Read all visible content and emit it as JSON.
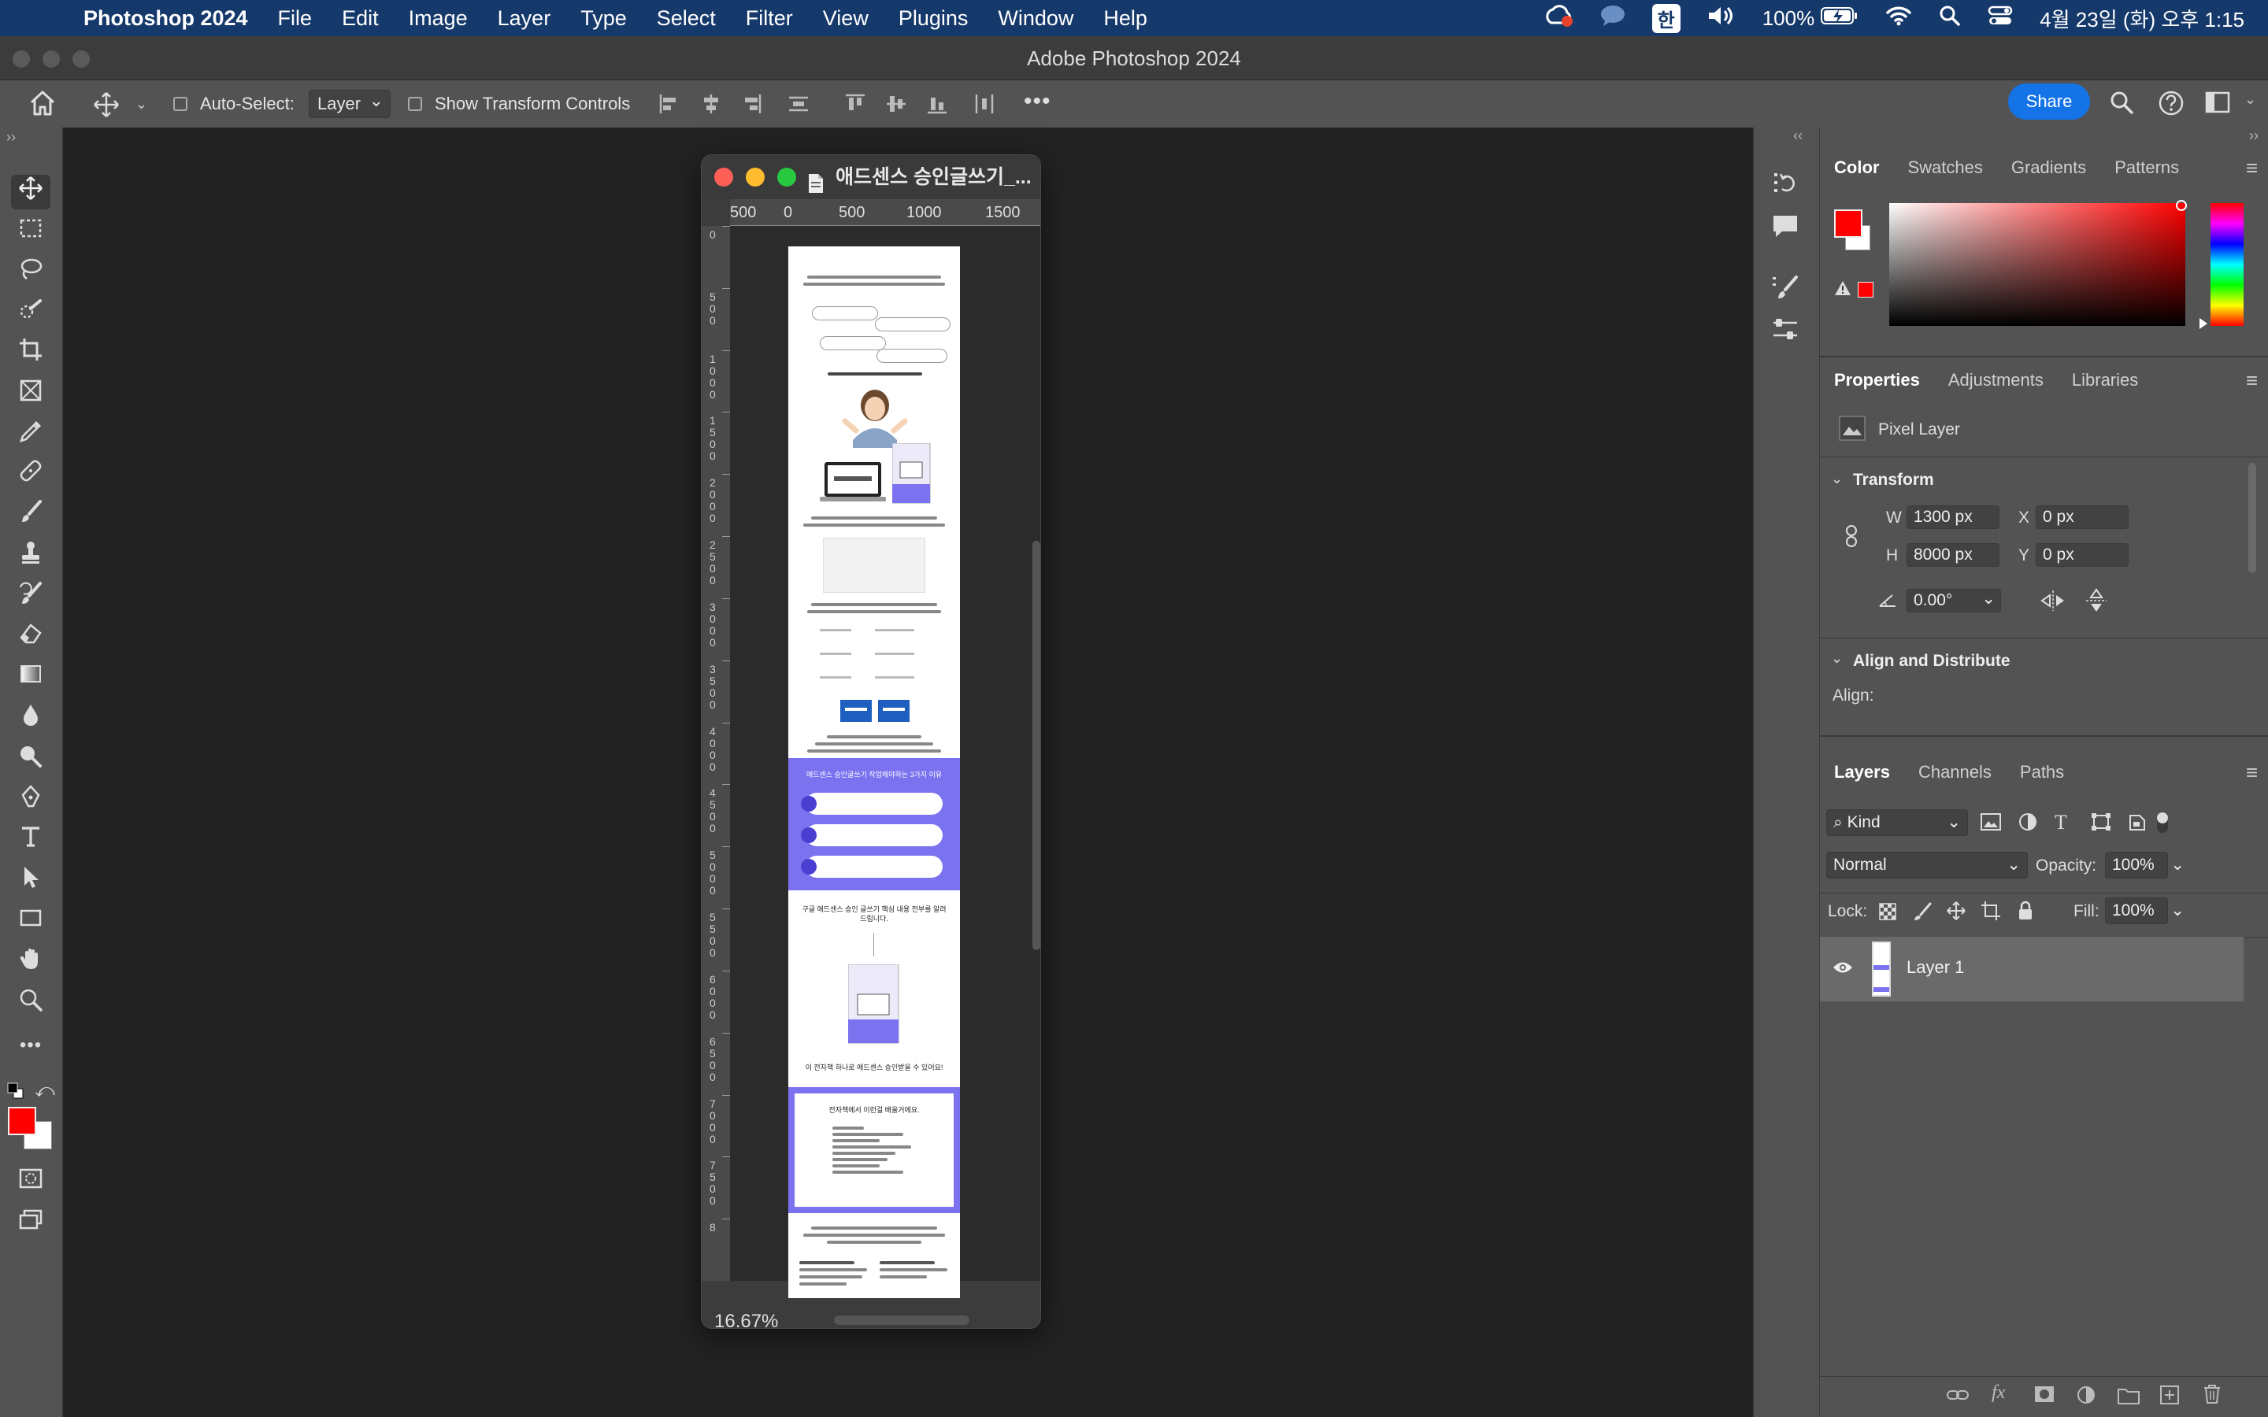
{
  "menubar": {
    "app_name": "Photoshop 2024",
    "items": [
      "File",
      "Edit",
      "Image",
      "Layer",
      "Type",
      "Select",
      "Filter",
      "View",
      "Plugins",
      "Window",
      "Help"
    ],
    "input_method": "한",
    "battery": "100%",
    "datetime": "4월 23일 (화) 오후 1:15"
  },
  "window": {
    "title": "Adobe Photoshop 2024"
  },
  "options": {
    "auto_select_label": "Auto-Select:",
    "auto_select_value": "Layer",
    "show_transform_label": "Show Transform Controls",
    "share_label": "Share"
  },
  "document": {
    "title": "애드센스 승인글쓰기_...",
    "zoom": "16.67%",
    "hruler_ticks": [
      "500",
      "0",
      "500",
      "1000",
      "1500"
    ],
    "vruler_ticks": [
      "0",
      "500",
      "1000",
      "1500",
      "2000",
      "2500",
      "3000",
      "3500",
      "4000",
      "4500",
      "5000",
      "5500",
      "6000",
      "6500",
      "7000",
      "7500",
      "8"
    ]
  },
  "color_panel": {
    "tabs": [
      "Color",
      "Swatches",
      "Gradients",
      "Patterns"
    ],
    "active_tab": "Color",
    "foreground": "#ff0000",
    "background": "#ffffff"
  },
  "properties_panel": {
    "tabs": [
      "Properties",
      "Adjustments",
      "Libraries"
    ],
    "layer_type": "Pixel Layer",
    "transform_title": "Transform",
    "w_label": "W",
    "w_value": "1300 px",
    "h_label": "H",
    "h_value": "8000 px",
    "x_label": "X",
    "x_value": "0 px",
    "y_label": "Y",
    "y_value": "0 px",
    "angle": "0.00°",
    "align_title": "Align and Distribute",
    "align_label": "Align:"
  },
  "layers_panel": {
    "tabs": [
      "Layers",
      "Channels",
      "Paths"
    ],
    "filter_kind": "Kind",
    "blend_mode": "Normal",
    "opacity_label": "Opacity:",
    "opacity": "100%",
    "lock_label": "Lock:",
    "fill_label": "Fill:",
    "fill": "100%",
    "layers": [
      {
        "name": "Layer 1",
        "visible": true
      }
    ]
  },
  "artboard_text": {
    "purple_heading": "애드센스 승인글쓰기 작업해야하는 3가지 이유",
    "section2_heading": "구글 애드센스 승인 글쓰기 핵심 내용 전부를 알려드립니다.",
    "section3_line": "이 전자책 하나로 애드센스 승인받을 수 있어요!",
    "box_heading": "전자책에서 이런걸 배울거에요."
  }
}
